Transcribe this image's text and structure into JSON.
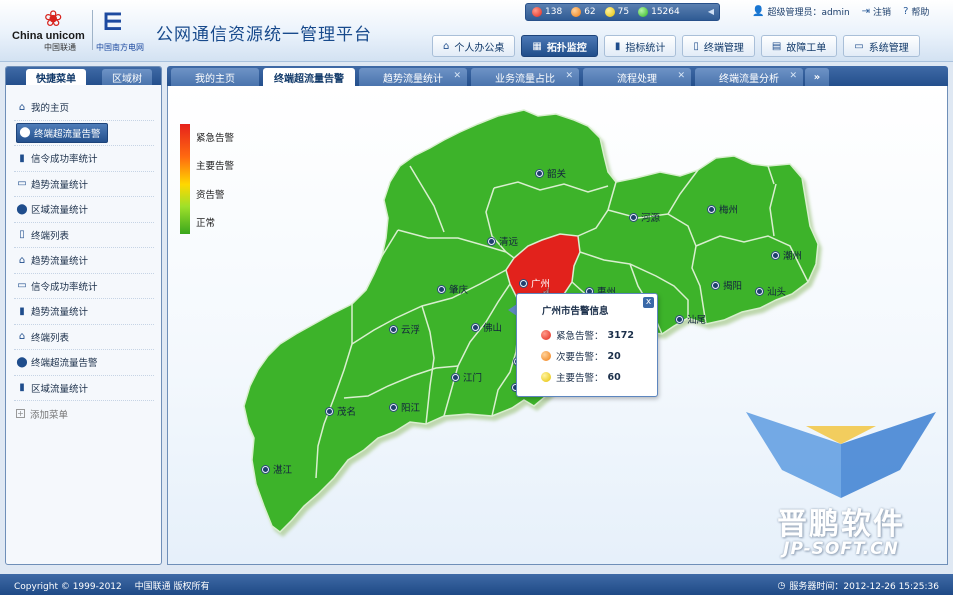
{
  "header": {
    "logo_cu_en": "China unicom",
    "logo_cu_cn": "中国联通",
    "logo_ns_cn": "中国南方电网",
    "title": "公网通信资源统一管理平台",
    "status": [
      {
        "color": "red",
        "count": "138"
      },
      {
        "color": "orange",
        "count": "62"
      },
      {
        "color": "yellow",
        "count": "75"
      },
      {
        "color": "green",
        "count": "15264"
      }
    ],
    "user_label": "超级管理员：admin",
    "logout_label": "注销",
    "help_label": "帮助",
    "nav": [
      {
        "label": "个人办公桌",
        "icon": "home-icon",
        "active": false
      },
      {
        "label": "拓扑监控",
        "icon": "topology-icon",
        "active": true
      },
      {
        "label": "指标统计",
        "icon": "bar-chart-icon",
        "active": false
      },
      {
        "label": "终端管理",
        "icon": "phone-icon",
        "active": false
      },
      {
        "label": "故障工单",
        "icon": "ticket-icon",
        "active": false
      },
      {
        "label": "系统管理",
        "icon": "monitor-icon",
        "active": false
      }
    ]
  },
  "sidebar": {
    "tabs": [
      "快捷菜单",
      "区域树"
    ],
    "items": [
      {
        "label": "我的主页",
        "icon": "home-icon"
      },
      {
        "label": "终端超流量告警",
        "icon": "location-pin-icon",
        "active": true
      },
      {
        "label": "信令成功率统计",
        "icon": "bar-chart-icon"
      },
      {
        "label": "趋势流量统计",
        "icon": "monitor-icon"
      },
      {
        "label": "区域流量统计",
        "icon": "location-pin-icon"
      },
      {
        "label": "终端列表",
        "icon": "phone-icon"
      },
      {
        "label": "趋势流量统计",
        "icon": "home-icon"
      },
      {
        "label": "信令成功率统计",
        "icon": "monitor-icon"
      },
      {
        "label": "趋势流量统计",
        "icon": "bar-chart-icon"
      },
      {
        "label": "终端列表",
        "icon": "home-icon"
      },
      {
        "label": "终端超流量告警",
        "icon": "location-pin-icon"
      },
      {
        "label": "区域流量统计",
        "icon": "bar-chart-icon"
      }
    ],
    "add_label": "添加菜单"
  },
  "tabs": [
    {
      "label": "我的主页",
      "closable": false,
      "active": false
    },
    {
      "label": "终端超流量告警",
      "closable": false,
      "active": true
    },
    {
      "label": "趋势流量统计",
      "closable": true,
      "active": false
    },
    {
      "label": "业务流量占比",
      "closable": true,
      "active": false
    },
    {
      "label": "流程处理",
      "closable": true,
      "active": false
    },
    {
      "label": "终端流量分析",
      "closable": true,
      "active": false
    },
    {
      "label": "»",
      "closable": false,
      "active": false
    }
  ],
  "map": {
    "legend": [
      "紧急告警",
      "主要告警",
      "资告警",
      "正常"
    ],
    "colors": {
      "normal": "#3eb32a",
      "urgent": "#e2241e",
      "border": "#d9efcf"
    },
    "cities": [
      {
        "name": "韶关",
        "status": "normal"
      },
      {
        "name": "清远",
        "status": "normal"
      },
      {
        "name": "河源",
        "status": "normal"
      },
      {
        "name": "梅州",
        "status": "normal"
      },
      {
        "name": "潮州",
        "status": "normal"
      },
      {
        "name": "广州",
        "status": "urgent"
      },
      {
        "name": "惠州",
        "status": "normal"
      },
      {
        "name": "肇庆",
        "status": "normal"
      },
      {
        "name": "揭阳",
        "status": "normal"
      },
      {
        "name": "汕头",
        "status": "normal"
      },
      {
        "name": "汕尾",
        "status": "normal"
      },
      {
        "name": "云浮",
        "status": "normal"
      },
      {
        "name": "佛山",
        "status": "normal"
      },
      {
        "name": "中山",
        "status": "normal"
      },
      {
        "name": "江门",
        "status": "normal"
      },
      {
        "name": "珠海",
        "status": "normal"
      },
      {
        "name": "茂名",
        "status": "normal"
      },
      {
        "name": "阳江",
        "status": "normal"
      },
      {
        "name": "湛江",
        "status": "normal"
      }
    ],
    "popup": {
      "title": "广州市告警信息",
      "rows": [
        {
          "color": "red",
          "label": "紧急告警：",
          "value": "3172"
        },
        {
          "color": "orange",
          "label": "次要告警：",
          "value": "20"
        },
        {
          "color": "yellow",
          "label": "主要告警：",
          "value": "60"
        }
      ],
      "close": "x"
    }
  },
  "watermark": {
    "text": "晋鹏软件",
    "sub": "JP-SOFT.CN"
  },
  "footer": {
    "copyright": "Copyright © 1999-2012",
    "owner": "中国联通  版权所有",
    "server_time": "服务器时间：2012-12-26 15:25:36"
  }
}
